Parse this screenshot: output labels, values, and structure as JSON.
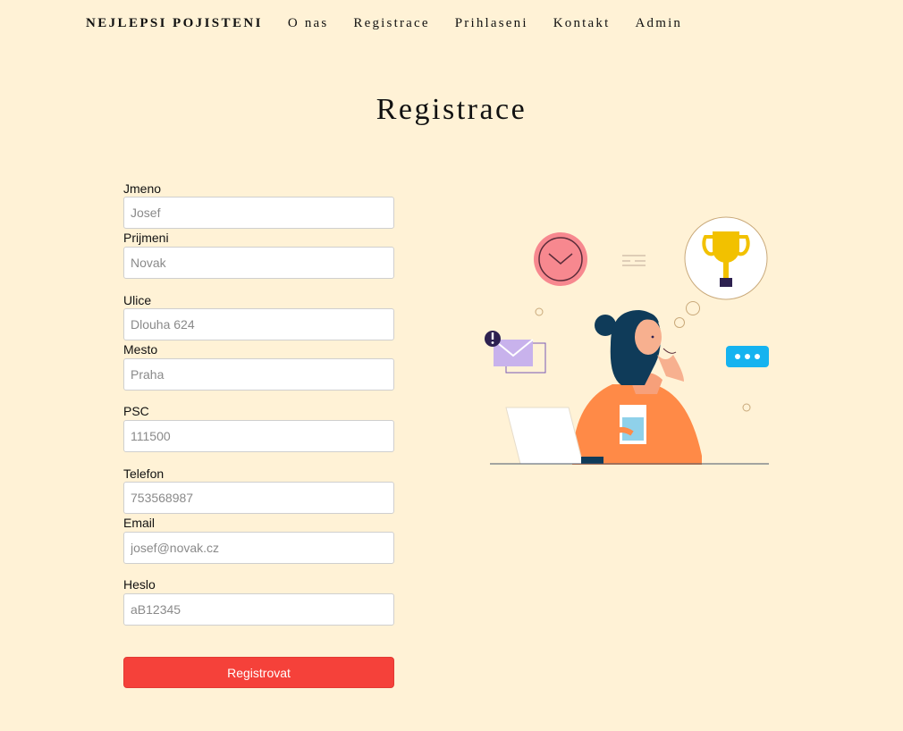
{
  "nav": {
    "brand": "NEJLEPSI POJISTENI",
    "links": [
      "O nas",
      "Registrace",
      "Prihlaseni",
      "Kontakt",
      "Admin"
    ]
  },
  "page_title": "Registrace",
  "form": {
    "fields": [
      {
        "label": "Jmeno",
        "placeholder": "Josef"
      },
      {
        "label": "Prijmeni",
        "placeholder": "Novak"
      },
      {
        "label": "Ulice",
        "placeholder": "Dlouha 624"
      },
      {
        "label": "Mesto",
        "placeholder": "Praha"
      },
      {
        "label": "PSC",
        "placeholder": "111500"
      },
      {
        "label": "Telefon",
        "placeholder": "753568987"
      },
      {
        "label": "Email",
        "placeholder": "josef@novak.cz"
      },
      {
        "label": "Heslo",
        "placeholder": "aB12345"
      }
    ],
    "submit_label": "Registrovat"
  },
  "colors": {
    "background": "#fff2d6",
    "accent": "#f5413a",
    "illustration_orange": "#ff8a47",
    "illustration_blue": "#15b3f0"
  },
  "illustration": {
    "icons": [
      "clock-icon",
      "trophy-icon",
      "email-icon",
      "chat-bubble-icon",
      "person-thinking-icon",
      "laptop-icon",
      "cup-icon"
    ]
  }
}
